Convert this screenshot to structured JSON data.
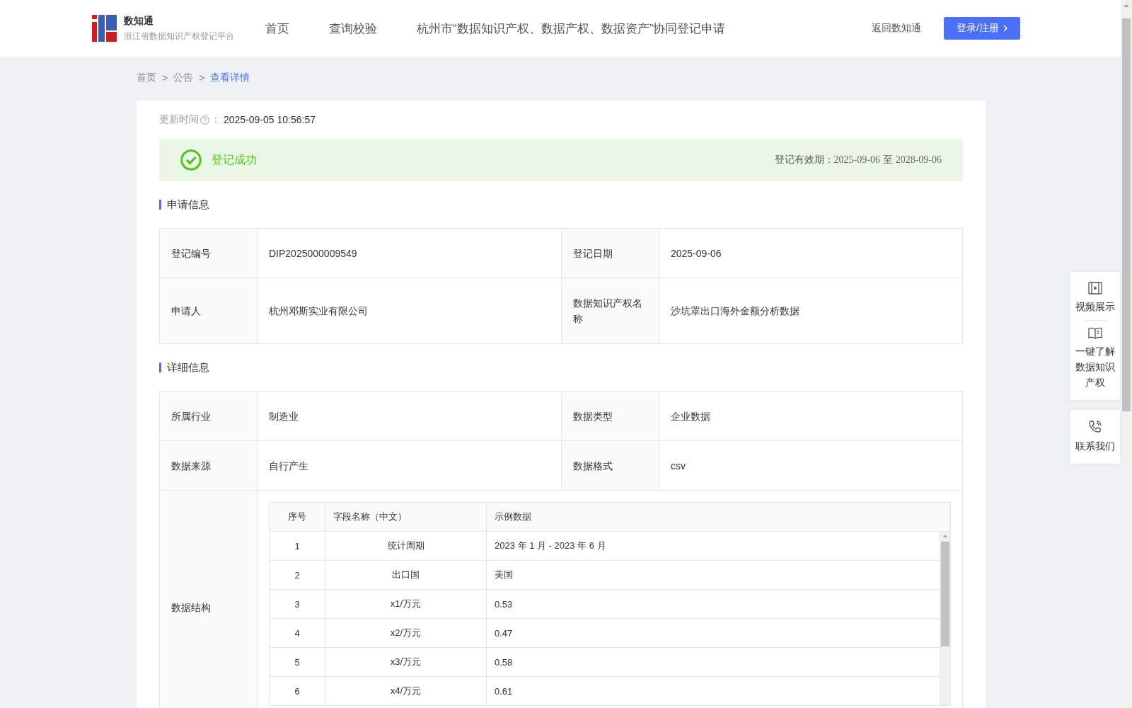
{
  "header": {
    "logo": {
      "title": "数知通",
      "subtitle": "浙江省数据知识产权登记平台"
    },
    "nav": [
      {
        "label": "首页",
        "selected": false
      },
      {
        "label": "查询校验",
        "selected": false
      },
      {
        "label": "杭州市“数据知识产权、数据产权、数据资产”协同登记申请",
        "selected": false
      }
    ],
    "back_link": "返回数知通",
    "login_button": "登录/注册"
  },
  "breadcrumb": [
    {
      "label": "首页",
      "selected": false,
      "separator": ">"
    },
    {
      "label": "公告",
      "selected": false,
      "separator": ">"
    },
    {
      "label": "查看详情",
      "selected": true
    }
  ],
  "update_time": {
    "label": "更新时间",
    "colon": "：",
    "value": "2025-09-05 10:56:57"
  },
  "status": {
    "text": "登记成功",
    "validity_label": "登记有效期：",
    "start": "2025-09-06",
    "separator": "至",
    "end": "2028-09-06"
  },
  "application": {
    "title": "申请信息",
    "rows": [
      {
        "cells": [
          {
            "label": "登记编号",
            "value": "DIP2025000009549"
          },
          {
            "label": "登记日期",
            "value": "2025-09-06"
          }
        ]
      },
      {
        "cells": [
          {
            "label": "申请人",
            "value": "杭州邓斯实业有限公司"
          },
          {
            "label": "数据知识产权名称",
            "value": "沙坑罩出口海外金额分析数据"
          }
        ]
      }
    ]
  },
  "details": {
    "title": "详细信息",
    "rows": [
      {
        "cells": [
          {
            "label": "所属行业",
            "value": "制造业"
          },
          {
            "label": "数据类型",
            "value": "企业数据"
          }
        ]
      },
      {
        "cells": [
          {
            "label": "数据来源",
            "value": "自行产生"
          },
          {
            "label": "数据格式",
            "value": "csv"
          }
        ]
      }
    ],
    "structure": {
      "label": "数据结构",
      "columns": [
        "序号",
        "字段名称（中文）",
        "示例数据"
      ],
      "rows": [
        [
          "1",
          "统计周期",
          "2023 年 1 月 - 2023 年 6 月"
        ],
        [
          "2",
          "出口国",
          "美国"
        ],
        [
          "3",
          "x1/万元",
          "0.53"
        ],
        [
          "4",
          "x2/万元",
          "0.47"
        ],
        [
          "5",
          "x3/万元",
          "0.58"
        ],
        [
          "6",
          "x4/万元",
          "0.61"
        ]
      ]
    }
  },
  "side_tools": [
    {
      "kind": "video",
      "label": "视频展示"
    },
    {
      "kind": "book",
      "label": "一键了解数据知识产权"
    },
    {
      "kind": "phone",
      "label": "联系我们"
    }
  ]
}
